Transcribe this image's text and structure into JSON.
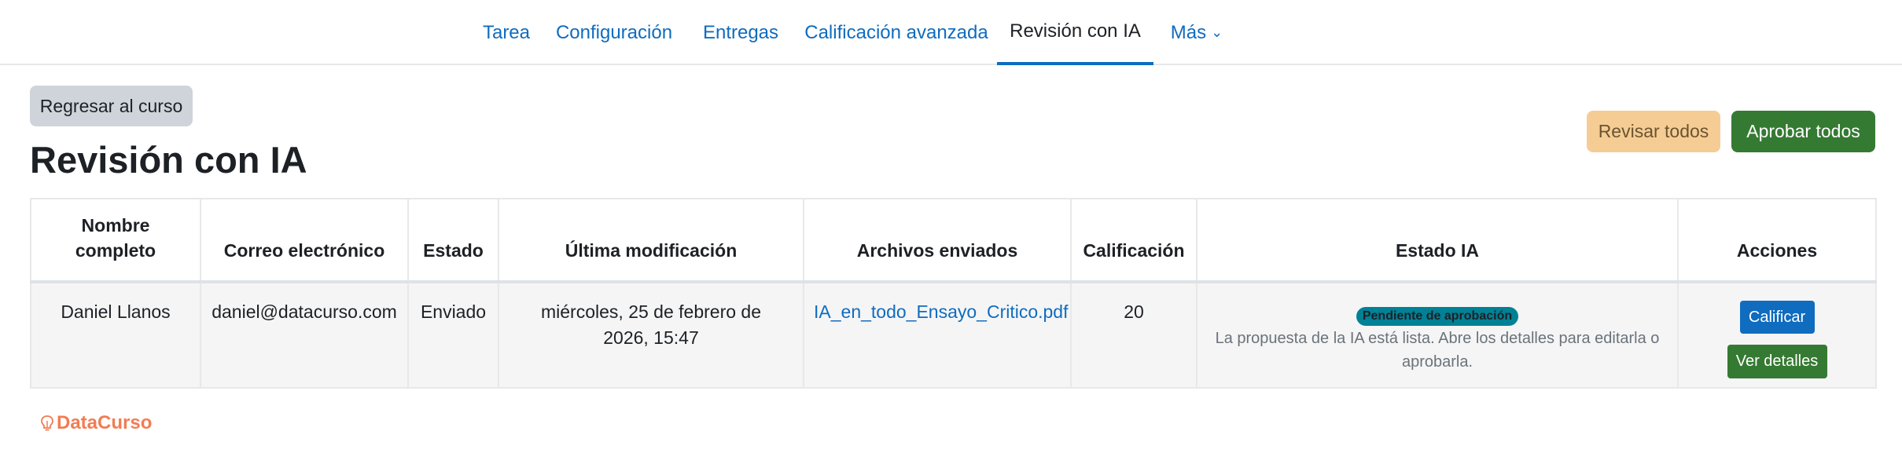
{
  "nav": {
    "tabs": [
      {
        "label": "Tarea"
      },
      {
        "label": "Configuración"
      },
      {
        "label": "Entregas"
      },
      {
        "label": "Calificación avanzada"
      },
      {
        "label": "Revisión con IA"
      },
      {
        "label": "Más"
      }
    ],
    "active_tab": "Revisión con IA"
  },
  "buttons": {
    "back": "Regresar al curso",
    "review_all": "Revisar todos",
    "approve_all": "Aprobar todos"
  },
  "page": {
    "title": "Revisión con IA"
  },
  "table": {
    "headers": {
      "name": "Nombre completo",
      "email": "Correo electrónico",
      "status": "Estado",
      "modified": "Última modificación",
      "files": "Archivos enviados",
      "grade": "Calificación",
      "ai_status": "Estado IA",
      "actions": "Acciones"
    },
    "rows": [
      {
        "name": "Daniel Llanos",
        "email": "daniel@datacurso.com",
        "status": "Enviado",
        "modified": "miércoles, 25 de febrero de 2026, 15:47",
        "file": "IA_en_todo_Ensayo_Critico.pdf",
        "grade": "20",
        "ai_badge": "Pendiente de aprobación",
        "ai_desc": "La propuesta de la IA está lista. Abre los detalles para editarla o aprobarla.",
        "action_grade": "Calificar",
        "action_details": "Ver detalles"
      }
    ]
  },
  "footer": {
    "brand": "DataCurso"
  },
  "colors": {
    "link": "#0f6cbf",
    "approve_green": "#357a32",
    "review_orange": "#f5cd94",
    "badge_teal": "#008196",
    "brand": "#f27c52"
  }
}
